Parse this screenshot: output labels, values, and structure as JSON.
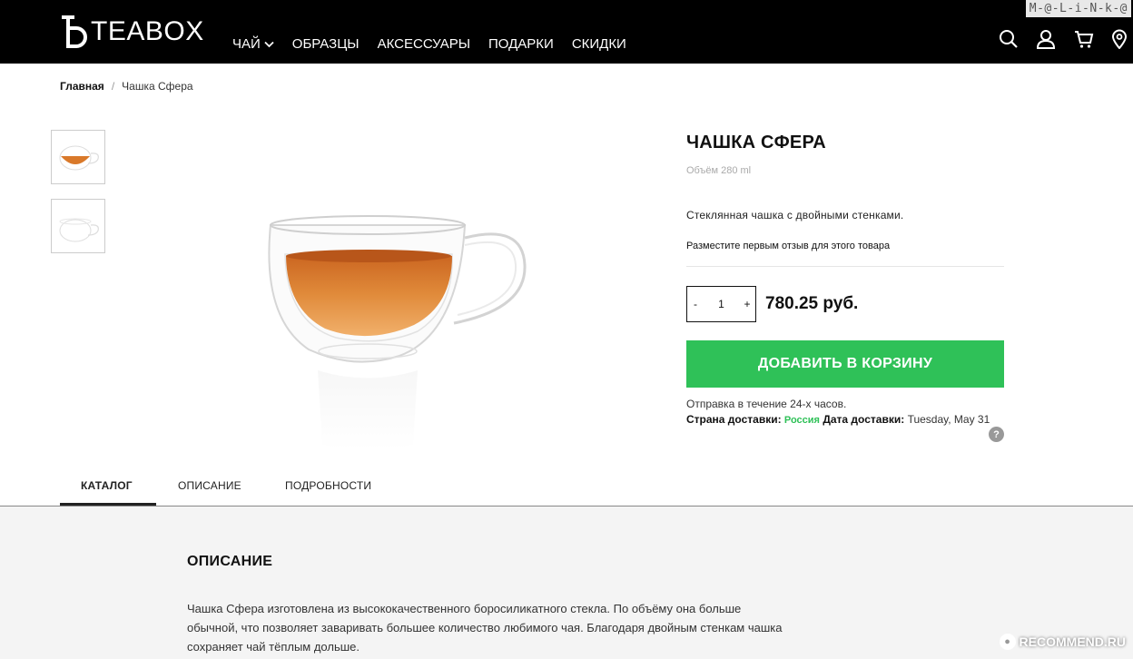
{
  "header": {
    "logo_text": "TEABOX",
    "nav": [
      {
        "label": "ЧАЙ"
      },
      {
        "label": "ОБРАЗЦЫ"
      },
      {
        "label": "АКСЕССУАРЫ"
      },
      {
        "label": "ПОДАРКИ"
      },
      {
        "label": "СКИДКИ"
      }
    ],
    "icons": [
      "search-icon",
      "account-icon",
      "cart-icon",
      "location-icon"
    ]
  },
  "watermark_top": "M-@-L-i-N-k-@",
  "breadcrumb": {
    "home": "Главная",
    "separator": "/",
    "current": "Чашка Сфера"
  },
  "product": {
    "title": "ЧАШКА СФЕРА",
    "volume": "Объём 280 ml",
    "short_description": "Стеклянная чашка с двойными стенками.",
    "review_link": "Разместите первым отзыв для этого товара",
    "quantity": {
      "minus": "-",
      "value": "1",
      "plus": "+"
    },
    "price": "780.25 руб.",
    "add_to_cart": "ДОБАВИТЬ В КОРЗИНУ",
    "shipping_note": "Отправка в течение 24-х часов.",
    "shipping": {
      "country_label": "Страна доставки:",
      "country": "Россия",
      "date_label": "Дата доставки:",
      "date": "Tuesday, May 31"
    },
    "help": "?"
  },
  "tabs": [
    {
      "label": "КАТАЛОГ",
      "active": true
    },
    {
      "label": "ОПИСАНИЕ",
      "active": false
    },
    {
      "label": "ПОДРОБНОСТИ",
      "active": false
    }
  ],
  "description": {
    "heading": "ОПИСАНИЕ",
    "text": "Чашка Сфера изготовлена из высококачественного боросиликатного стекла. По объёму она больше обычной, что позволяет заваривать большее количество любимого чая. Благодаря двойным стенкам чашка сохраняет чай тёплым дольше."
  },
  "watermark_bottom": "RECOMMEND.RU",
  "colors": {
    "header_bg": "#000000",
    "accent_green": "#2fc158",
    "tea": "#d9792a",
    "section_bg": "#f4f4f4"
  }
}
